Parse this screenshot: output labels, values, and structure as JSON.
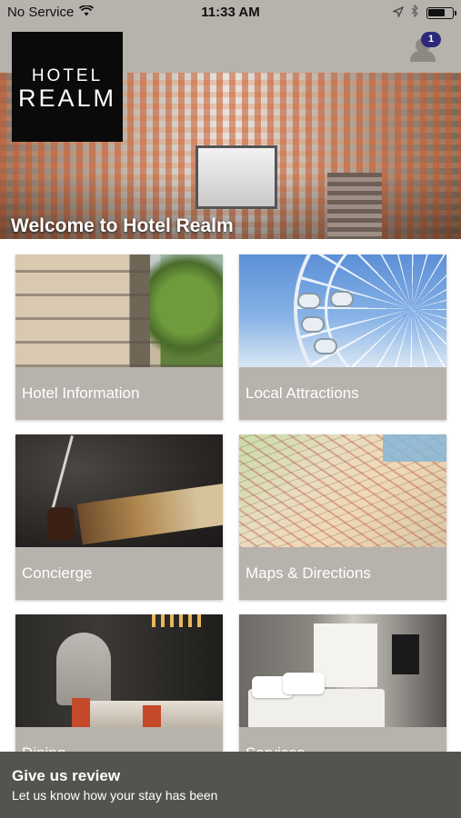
{
  "status_bar": {
    "carrier": "No Service",
    "time": "11:33 AM",
    "icons": [
      "wifi-icon",
      "location-arrow-icon",
      "bluetooth-icon",
      "battery-icon"
    ]
  },
  "header": {
    "logo_line1": "HOTEL",
    "logo_line2": "REALM",
    "notification_count": "1",
    "bar_color": "#b8b2ad",
    "badge_color": "#2c2a78"
  },
  "hero": {
    "title": "Welcome to Hotel Realm"
  },
  "tiles": [
    {
      "label": "Hotel Information"
    },
    {
      "label": "Local Attractions"
    },
    {
      "label": "Concierge"
    },
    {
      "label": "Maps & Directions"
    },
    {
      "label": "Dining"
    },
    {
      "label": "Services"
    }
  ],
  "review_banner": {
    "title": "Give us review",
    "subtitle": "Let us know how your stay has been",
    "color": "#55534f"
  }
}
